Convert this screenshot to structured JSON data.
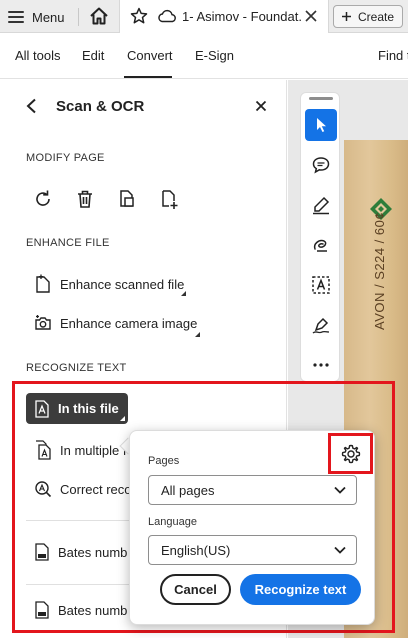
{
  "tabbar": {
    "menu_label": "Menu",
    "doc_title": "1- Asimov - Foundat...",
    "create_label": "Create"
  },
  "toolbar": {
    "items": [
      "All tools",
      "Edit",
      "Convert",
      "E-Sign",
      "Find t"
    ],
    "active": "Convert"
  },
  "panel": {
    "title": "Scan & OCR",
    "sections": {
      "modify": "MODIFY PAGE",
      "enhance": "ENHANCE FILE",
      "recognize": "RECOGNIZE TEXT"
    },
    "enhance_items": [
      "Enhance scanned file",
      "Enhance camera image"
    ],
    "recognize_items": {
      "in_this_file": "In this file",
      "in_multiple": "In multiple f",
      "correct": "Correct reco",
      "bates1": "Bates numb",
      "bates2": "Bates numb"
    }
  },
  "document": {
    "spine_text": "AVON / S224 / 60¢"
  },
  "popup": {
    "pages_label": "Pages",
    "pages_value": "All pages",
    "language_label": "Language",
    "language_value": "English(US)",
    "cancel_label": "Cancel",
    "recognize_label": "Recognize text"
  },
  "colors": {
    "accent": "#1473e6",
    "highlight": "#e3161d",
    "active_row": "#3c3c3c"
  }
}
